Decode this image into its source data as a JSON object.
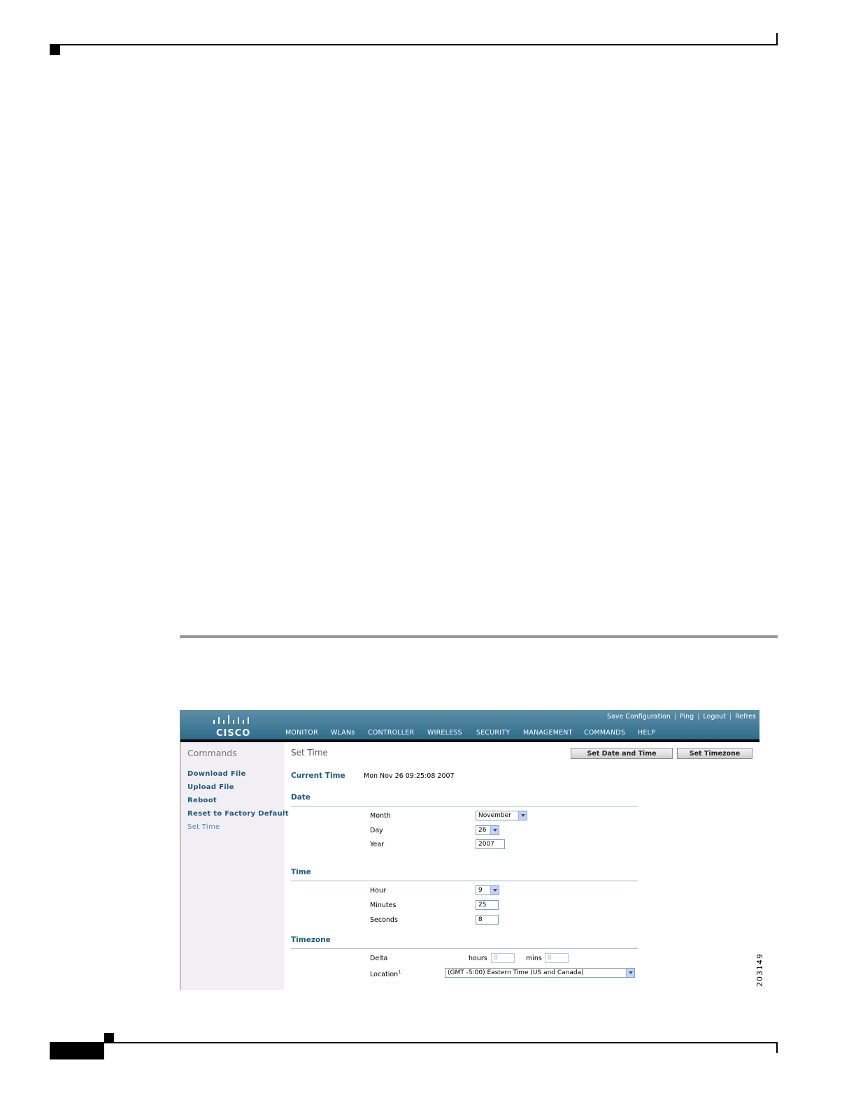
{
  "figure_id": "203149",
  "app": {
    "logo_text": "CISCO",
    "top_links": [
      "Save Configuration",
      "Ping",
      "Logout",
      "Refres"
    ],
    "nav": [
      "MONITOR",
      "WLANs",
      "CONTROLLER",
      "WIRELESS",
      "SECURITY",
      "MANAGEMENT",
      "COMMANDS",
      "HELP"
    ],
    "active_nav": "COMMANDS"
  },
  "sidebar": {
    "title": "Commands",
    "items": [
      "Download File",
      "Upload File",
      "Reboot",
      "Reset to Factory Default",
      "Set Time"
    ],
    "current": "Set Time"
  },
  "main": {
    "title": "Set Time",
    "buttons": {
      "set_date_time": "Set Date and Time",
      "set_timezone": "Set Timezone"
    },
    "current_time_label": "Current Time",
    "current_time_value": "Mon Nov 26 09:25:08 2007",
    "date": {
      "heading": "Date",
      "month_label": "Month",
      "month_value": "November",
      "day_label": "Day",
      "day_value": "26",
      "year_label": "Year",
      "year_value": "2007"
    },
    "time": {
      "heading": "Time",
      "hour_label": "Hour",
      "hour_value": "9",
      "minutes_label": "Minutes",
      "minutes_value": "25",
      "seconds_label": "Seconds",
      "seconds_value": "8"
    },
    "timezone": {
      "heading": "Timezone",
      "delta_label": "Delta",
      "hours_label": "hours",
      "hours_value": "0",
      "mins_label": "mins",
      "mins_value": "0",
      "location_label": "Location",
      "location_footnote": "1",
      "location_value": "(GMT -5:00) Eastern Time (US and Canada)"
    }
  },
  "colors": {
    "header": "#2f6c8b",
    "accent": "#e49a29",
    "link": "#215a7d",
    "sidebar_bg": "#f2eff4"
  }
}
